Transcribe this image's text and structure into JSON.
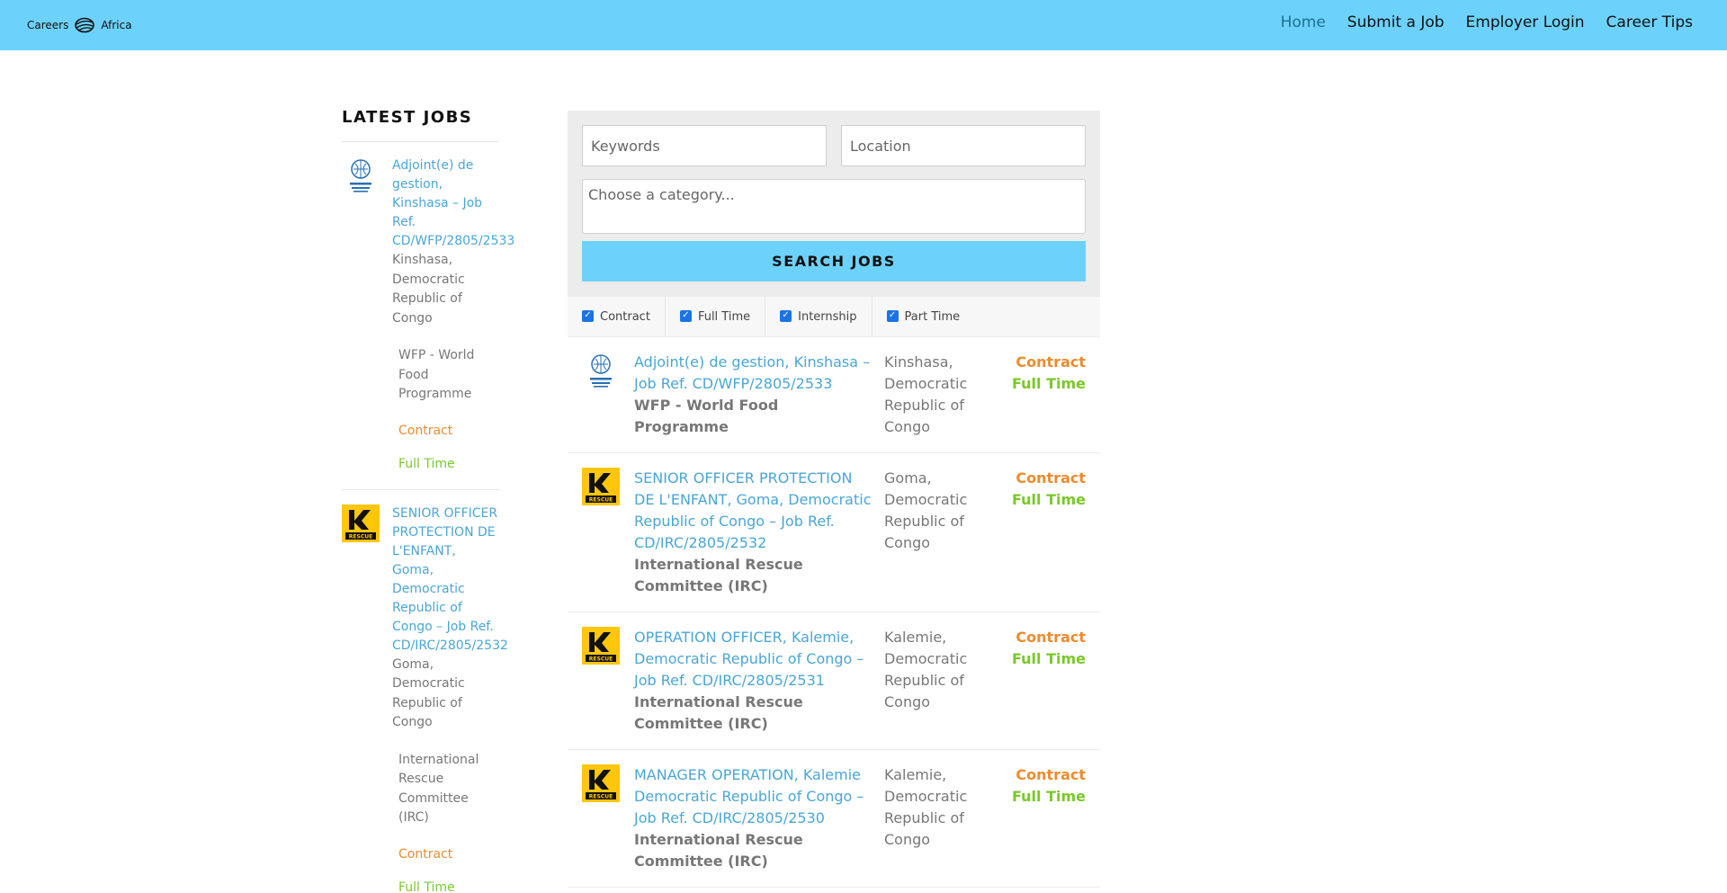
{
  "header": {
    "logo_left": "Careers",
    "logo_right": "Africa",
    "nav": [
      {
        "label": "Home",
        "active": true
      },
      {
        "label": "Submit a Job",
        "active": false
      },
      {
        "label": "Employer Login",
        "active": false
      },
      {
        "label": "Career Tips",
        "active": false
      }
    ]
  },
  "sidebar": {
    "heading": "LATEST JOBS",
    "items": [
      {
        "title": "Adjoint(e) de gestion, Kinshasa – Job Ref. CD/WFP/2805/2533",
        "location": "Kinshasa, Democratic Republic of Congo",
        "org": "WFP - World Food Programme",
        "type1": "Contract",
        "type2": "Full Time",
        "logo": "wfp-logo"
      },
      {
        "title": "SENIOR OFFICER PROTECTION DE L'ENFANT, Goma, Democratic Republic of Congo – Job Ref. CD/IRC/2805/2532",
        "location": "Goma, Democratic Republic of Congo",
        "org": "International Rescue Committee (IRC)",
        "type1": "Contract",
        "type2": "Full Time",
        "logo": "irc-logo"
      }
    ]
  },
  "search": {
    "keywords_placeholder": "Keywords",
    "location_placeholder": "Location",
    "category_placeholder": "Choose a category...",
    "button": "SEARCH JOBS"
  },
  "filters": [
    {
      "label": "Contract",
      "checked": true
    },
    {
      "label": "Full Time",
      "checked": true
    },
    {
      "label": "Internship",
      "checked": true
    },
    {
      "label": "Part Time",
      "checked": true
    }
  ],
  "jobs": [
    {
      "title": "Adjoint(e) de gestion, Kinshasa – Job Ref. CD/WFP/2805/2533",
      "org": "WFP - World Food Programme",
      "location": "Kinshasa, Democratic Republic of Congo",
      "type1": "Contract",
      "type2": "Full Time",
      "logo": "wfp-logo"
    },
    {
      "title": "SENIOR OFFICER PROTECTION DE L'ENFANT, Goma, Democratic Republic of Congo – Job Ref. CD/IRC/2805/2532",
      "org": "International Rescue Committee (IRC)",
      "location": "Goma, Democratic Republic of Congo",
      "type1": "Contract",
      "type2": "Full Time",
      "logo": "irc-logo"
    },
    {
      "title": "OPERATION OFFICER, Kalemie, Democratic Republic of Congo – Job Ref. CD/IRC/2805/2531",
      "org": "International Rescue Committee (IRC)",
      "location": "Kalemie, Democratic Republic of Congo",
      "type1": "Contract",
      "type2": "Full Time",
      "logo": "irc-logo"
    },
    {
      "title": "MANAGER OPERATION, Kalemie Democratic Republic of Congo – Job Ref. CD/IRC/2805/2530",
      "org": "International Rescue Committee (IRC)",
      "location": "Kalemie, Democratic Republic of Congo",
      "type1": "Contract",
      "type2": "Full Time",
      "logo": "irc-logo"
    }
  ],
  "colors": {
    "header_bg": "#6dd2fb",
    "link": "#4aa6d6",
    "contract": "#ee8b2d",
    "full_time": "#7ac82b"
  }
}
